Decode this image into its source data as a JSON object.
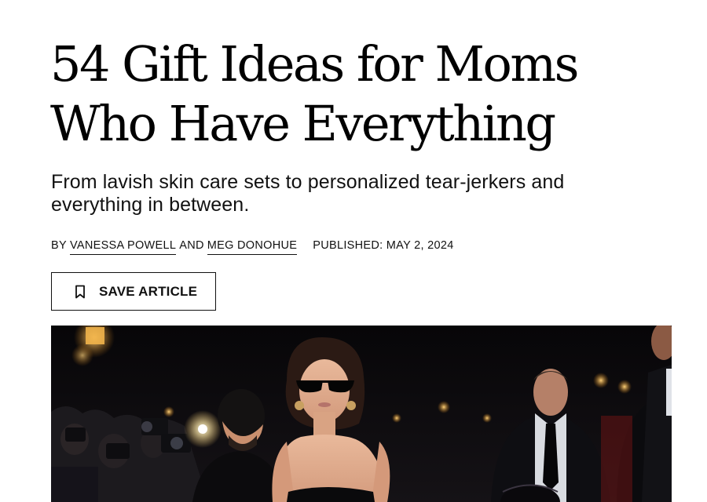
{
  "article": {
    "headline": "54 Gift Ideas for Moms Who Have Everything",
    "dek": "From lavish skin care sets to personalized tear-jerkers and everything in between.",
    "byline": {
      "prefix": "BY",
      "author_1": "VANESSA POWELL",
      "conjunction": "AND",
      "author_2": "MEG DONOHUE",
      "published": "PUBLISHED: MAY 2, 2024"
    },
    "save_button": {
      "label": "SAVE ARTICLE",
      "icon": "bookmark-icon"
    },
    "hero_image": {
      "subject": "woman in sunglasses and strapless black gown at night red-carpet event with photographers"
    }
  },
  "colors": {
    "text": "#000000",
    "background": "#ffffff",
    "hero_bg": "#0b0a0c"
  }
}
